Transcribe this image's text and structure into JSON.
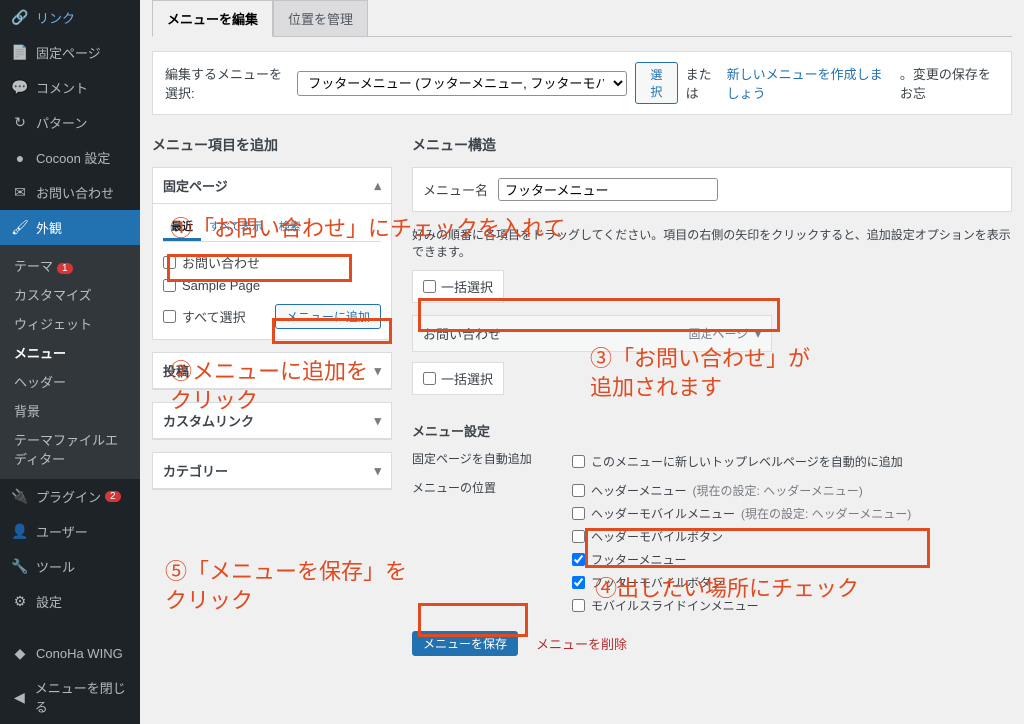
{
  "sidebar": {
    "items": [
      {
        "icon": "🔗",
        "label": "リンク"
      },
      {
        "icon": "📄",
        "label": "固定ページ"
      },
      {
        "icon": "💬",
        "label": "コメント"
      },
      {
        "icon": "↻",
        "label": "パターン"
      },
      {
        "icon": "●",
        "label": "Cocoon 設定"
      },
      {
        "icon": "✉",
        "label": "お問い合わせ"
      },
      {
        "icon": "🖌",
        "label": "外観",
        "active": true
      },
      {
        "icon": "🔌",
        "label": "プラグイン",
        "badge": "2"
      },
      {
        "icon": "👤",
        "label": "ユーザー"
      },
      {
        "icon": "🔧",
        "label": "ツール"
      },
      {
        "icon": "⚙",
        "label": "設定"
      },
      {
        "icon": "◆",
        "label": "ConoHa WING"
      },
      {
        "icon": "◀",
        "label": "メニューを閉じる"
      }
    ],
    "sub": [
      {
        "label": "テーマ",
        "badge": "1"
      },
      {
        "label": "カスタマイズ"
      },
      {
        "label": "ウィジェット"
      },
      {
        "label": "メニュー",
        "current": true
      },
      {
        "label": "ヘッダー"
      },
      {
        "label": "背景"
      },
      {
        "label": "テーマファイルエディター"
      }
    ]
  },
  "tabs": {
    "edit": "メニューを編集",
    "positions": "位置を管理"
  },
  "selectMenu": {
    "label": "編集するメニューを選択:",
    "value": "フッターメニュー (フッターメニュー, フッターモバイルボタン)",
    "button": "選択",
    "or": "または",
    "newLink": "新しいメニューを作成しましょう",
    "tail": "。変更の保存をお忘"
  },
  "addHeader": "メニュー項目を追加",
  "structHeader": "メニュー構造",
  "panels": {
    "fixed": {
      "title": "固定ページ",
      "tabs": [
        "最近",
        "すべて表示",
        "検索"
      ],
      "items": [
        "お問い合わせ",
        "Sample Page"
      ],
      "selectAll": "すべて選択",
      "add": "メニューに追加"
    },
    "posts": "投稿",
    "custom": "カスタムリンク",
    "category": "カテゴリー"
  },
  "menuName": {
    "label": "メニュー名",
    "value": "フッターメニュー"
  },
  "help": "好みの順番に各項目をドラッグしてください。項目の右側の矢印をクリックすると、追加設定オプションを表示できます。",
  "bulk": "一括選択",
  "addedItem": {
    "title": "お問い合わせ",
    "type": "固定ページ"
  },
  "settings": {
    "title": "メニュー設定",
    "autoAdd": {
      "label": "固定ページを自動追加",
      "text": "このメニューに新しいトップレベルページを自動的に追加"
    },
    "loc": {
      "label": "メニューの位置",
      "opts": [
        {
          "label": "ヘッダーメニュー",
          "note": "(現在の設定: ヘッダーメニュー)",
          "checked": false
        },
        {
          "label": "ヘッダーモバイルメニュー",
          "note": "(現在の設定: ヘッダーメニュー)",
          "checked": false
        },
        {
          "label": "ヘッダーモバイルボタン",
          "checked": false
        },
        {
          "label": "フッターメニュー",
          "checked": true
        },
        {
          "label": "フッターモバイルボタン",
          "checked": true
        },
        {
          "label": "モバイルスライドインメニュー",
          "checked": false
        }
      ]
    }
  },
  "save": "メニューを保存",
  "delete": "メニューを削除",
  "anno": {
    "a1": "①「お問い合わせ」にチェックを入れて",
    "a2": "②メニューに追加を\nクリック",
    "a3": "③「お問い合わせ」が\n追加されます",
    "a4": "④出したい場所にチェック",
    "a5": "⑤「メニューを保存」を\nクリック"
  }
}
